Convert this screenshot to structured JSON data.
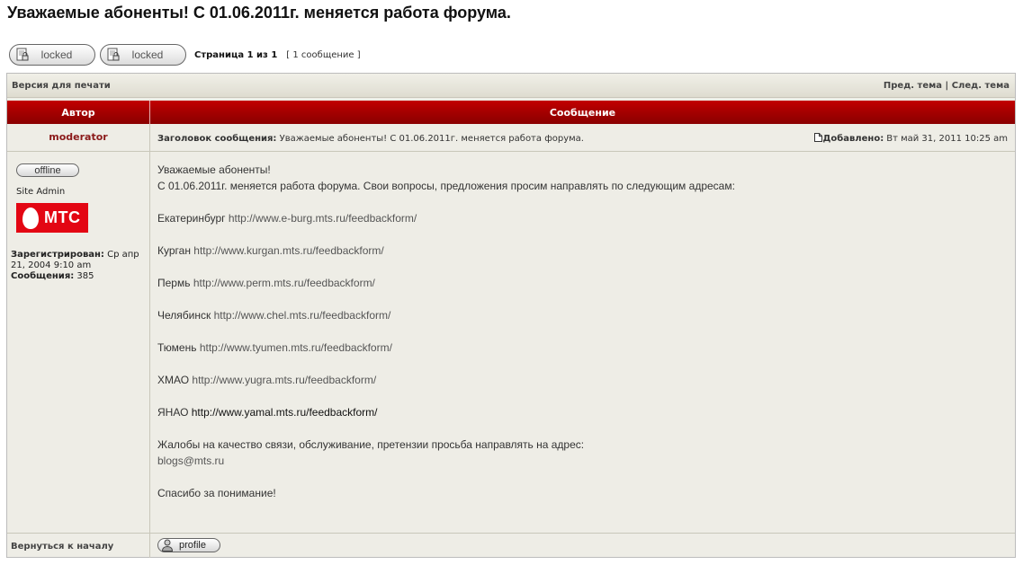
{
  "page": {
    "title": "Уважаемые абоненты! С 01.06.2011г. меняется работа форума."
  },
  "toolbar": {
    "buttons": [
      {
        "label": "locked"
      },
      {
        "label": "locked"
      }
    ],
    "pagination": "Страница 1 из 1",
    "post_count": "[ 1 сообщение ]"
  },
  "nav": {
    "print_version": "Версия для печати",
    "prev_topic": "Пред. тема",
    "separator": "|",
    "next_topic": "След. тема"
  },
  "table_header": {
    "author": "Автор",
    "message": "Сообщение"
  },
  "post": {
    "author": "moderator",
    "subject_label": "Заголовок сообщения:",
    "subject": "Уважаемые абоненты! С 01.06.2011г. меняется работа форума.",
    "posted_label": "Добавлено:",
    "posted": "Вт май 31, 2011 10:25 am",
    "status": "offline",
    "rank": "Site Admin",
    "logo_text": "МТС",
    "registered_label": "Зарегистрирован:",
    "registered": "Ср апр 21, 2004 9:10 am",
    "posts_label": "Сообщения:",
    "posts": "385",
    "body": {
      "greeting": "Уважаемые абоненты!",
      "intro": "С 01.06.2011г. меняется работа форума. Свои вопросы, предложения просим направлять по следующим адресам:",
      "cities": [
        {
          "city": "Екатеринбург",
          "url": "http://www.e-burg.mts.ru/feedbackform/"
        },
        {
          "city": "Курган",
          "url": "http://www.kurgan.mts.ru/feedbackform/"
        },
        {
          "city": "Пермь",
          "url": "http://www.perm.mts.ru/feedbackform/"
        },
        {
          "city": "Челябинск",
          "url": "http://www.chel.mts.ru/feedbackform/"
        },
        {
          "city": "Тюмень",
          "url": "http://www.tyumen.mts.ru/feedbackform/"
        },
        {
          "city": "ХМАО",
          "url": "http://www.yugra.mts.ru/feedbackform/"
        },
        {
          "city": "ЯНАО",
          "url": "http://www.yamal.mts.ru/feedbackform/"
        }
      ],
      "complaints": "Жалобы на качество связи, обслуживание, претензии просьба направлять на адрес:",
      "email": "blogs@mts.ru",
      "thanks": "Спасибо за понимание!"
    }
  },
  "footer": {
    "back_to_top": "Вернуться к началу",
    "profile": "profile"
  },
  "colors": {
    "header_red": "#a40000",
    "author_red": "#8b1a1a",
    "row_bg": "#eeede6",
    "logo_red": "#e30613"
  }
}
